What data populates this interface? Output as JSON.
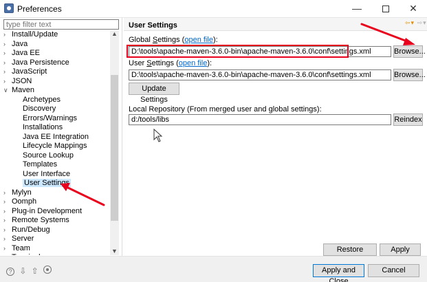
{
  "window": {
    "title": "Preferences",
    "minimize": "—",
    "close": "✕"
  },
  "filter": {
    "placeholder": "type filter text"
  },
  "tree": {
    "items": [
      {
        "label": "Install/Update",
        "expanded": false,
        "level": 0
      },
      {
        "label": "Java",
        "expanded": false,
        "level": 0
      },
      {
        "label": "Java EE",
        "expanded": false,
        "level": 0
      },
      {
        "label": "Java Persistence",
        "expanded": false,
        "level": 0
      },
      {
        "label": "JavaScript",
        "expanded": false,
        "level": 0
      },
      {
        "label": "JSON",
        "expanded": false,
        "level": 0
      },
      {
        "label": "Maven",
        "expanded": true,
        "level": 0
      },
      {
        "label": "Archetypes",
        "level": 1
      },
      {
        "label": "Discovery",
        "level": 1
      },
      {
        "label": "Errors/Warnings",
        "level": 1
      },
      {
        "label": "Installations",
        "level": 1
      },
      {
        "label": "Java EE Integration",
        "level": 1
      },
      {
        "label": "Lifecycle Mappings",
        "level": 1
      },
      {
        "label": "Source Lookup",
        "level": 1
      },
      {
        "label": "Templates",
        "level": 1
      },
      {
        "label": "User Interface",
        "level": 1
      },
      {
        "label": "User Settings",
        "level": 1,
        "selected": true
      },
      {
        "label": "Mylyn",
        "expanded": false,
        "level": 0
      },
      {
        "label": "Oomph",
        "expanded": false,
        "level": 0
      },
      {
        "label": "Plug-in Development",
        "expanded": false,
        "level": 0
      },
      {
        "label": "Remote Systems",
        "expanded": false,
        "level": 0
      },
      {
        "label": "Run/Debug",
        "expanded": false,
        "level": 0
      },
      {
        "label": "Server",
        "expanded": false,
        "level": 0
      },
      {
        "label": "Team",
        "expanded": false,
        "level": 0
      },
      {
        "label": "Terminal",
        "expanded": false,
        "level": 0
      }
    ]
  },
  "panel": {
    "title": "User Settings",
    "global_label_pre": "Global ",
    "global_label_u": "S",
    "global_label_post": "ettings (",
    "global_link": "open file",
    "global_close": "):",
    "global_path": "D:\\tools\\apache-maven-3.6.0-bin\\apache-maven-3.6.0\\conf\\settings.xml",
    "browse_label": "Browse...",
    "user_label_pre": "User ",
    "user_label_u": "S",
    "user_label_post": "ettings (",
    "user_link": "open file",
    "user_close": "):",
    "user_path": "D:\\tools\\apache-maven-3.6.0-bin\\apache-maven-3.6.0\\conf\\settings.xml",
    "browse2_label": "Browse...",
    "update_label": "Update Settings",
    "local_repo_label": "Local Repository (From merged user and global settings):",
    "local_repo_value": "d:/tools/libs",
    "reindex_label": "Reindex",
    "restore_label": "Restore Defaults",
    "apply_label": "Apply"
  },
  "footer": {
    "apply_close_label": "Apply and Close",
    "cancel_label": "Cancel",
    "help_glyph": "?"
  },
  "colors": {
    "annotation_red": "#e8001c",
    "selection": "#cce8ff",
    "link": "#0066cc"
  }
}
